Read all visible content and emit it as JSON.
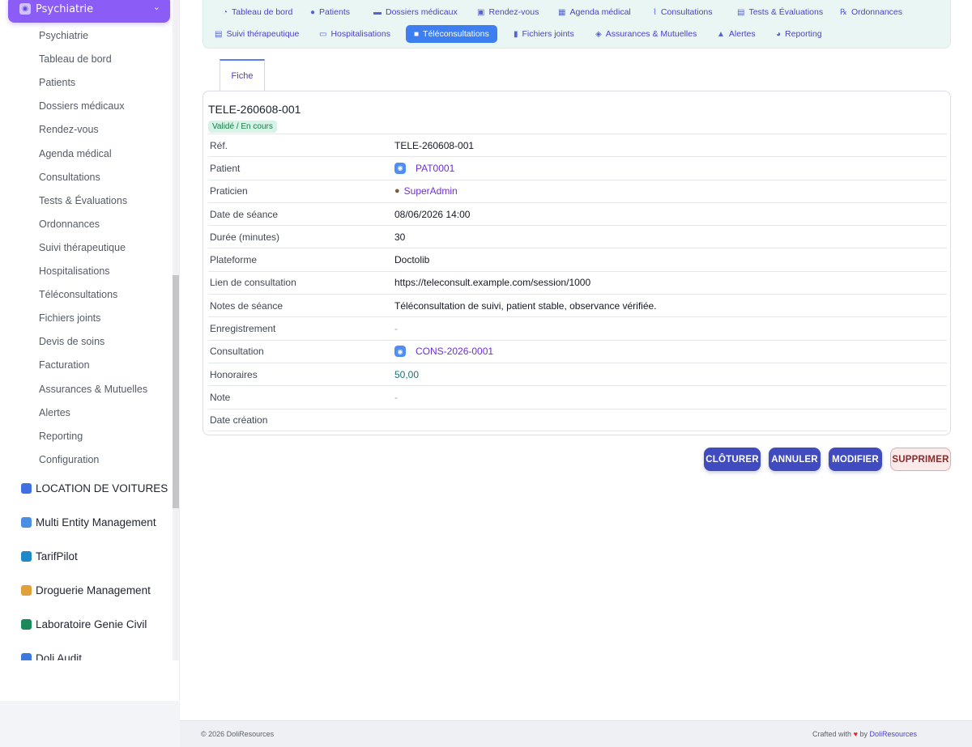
{
  "sidebar": {
    "active_module": {
      "label": "Psychiatrie",
      "icon": "brain-icon"
    },
    "sub_items": [
      "Psychiatrie",
      "Tableau de bord",
      "Patients",
      "Dossiers médicaux",
      "Rendez-vous",
      "Agenda médical",
      "Consultations",
      "Tests & Évaluations",
      "Ordonnances",
      "Suivi thérapeutique",
      "Hospitalisations",
      "Téléconsultations",
      "Fichiers joints",
      "Devis de soins",
      "Facturation",
      "Assurances & Mutuelles",
      "Alertes",
      "Reporting",
      "Configuration"
    ],
    "modules": [
      {
        "label": "LOCATION DE VOITURES",
        "icon": "car-icon",
        "color": "#3f6fe0"
      },
      {
        "label": "Multi Entity Management",
        "icon": "building-icon",
        "color": "#4a90e2"
      },
      {
        "label": "TarifPilot",
        "icon": "tag-icon",
        "color": "#1e88c9"
      },
      {
        "label": "Droguerie Management",
        "icon": "shop-icon",
        "color": "#e0a13a"
      },
      {
        "label": "Laboratoire Genie Civil",
        "icon": "lab-icon",
        "color": "#1a8a5a"
      },
      {
        "label": "Doli Audit",
        "icon": "audit-icon",
        "color": "#3b7be0"
      }
    ]
  },
  "nav_tabs": [
    {
      "label": "Tableau de bord",
      "icon": "gauge-icon"
    },
    {
      "label": "Patients",
      "icon": "user-icon"
    },
    {
      "label": "Dossiers médicaux",
      "icon": "folder-icon"
    },
    {
      "label": "Rendez-vous",
      "icon": "calendar-check-icon"
    },
    {
      "label": "Agenda médical",
      "icon": "calendar-icon"
    },
    {
      "label": "Consultations",
      "icon": "stethoscope-icon"
    },
    {
      "label": "Tests & Évaluations",
      "icon": "clipboard-icon"
    },
    {
      "label": "Ordonnances",
      "icon": "prescription-icon"
    },
    {
      "label": "Suivi thérapeutique",
      "icon": "notes-icon"
    },
    {
      "label": "Hospitalisations",
      "icon": "bed-icon"
    },
    {
      "label": "Téléconsultations",
      "icon": "video-icon",
      "active": true
    },
    {
      "label": "Fichiers joints",
      "icon": "file-icon"
    },
    {
      "label": "Assurances & Mutuelles",
      "icon": "shield-icon"
    },
    {
      "label": "Alertes",
      "icon": "warning-icon"
    },
    {
      "label": "Reporting",
      "icon": "pie-chart-icon"
    }
  ],
  "subtab": {
    "label": "Fiche"
  },
  "record": {
    "title": "TELE-260608-001",
    "status": "Validé / En cours",
    "fields": [
      {
        "label": "Réf.",
        "value": "TELE-260608-001"
      },
      {
        "label": "Patient",
        "value": "PAT0001",
        "type": "link",
        "icon": "patient-icon"
      },
      {
        "label": "Praticien",
        "value": "SuperAdmin",
        "type": "user",
        "icon": "user-icon"
      },
      {
        "label": "Date de séance",
        "value": "08/06/2026 14:00"
      },
      {
        "label": "Durée (minutes)",
        "value": "30"
      },
      {
        "label": "Plateforme",
        "value": "Doctolib"
      },
      {
        "label": "Lien de consultation",
        "value": "https://teleconsult.example.com/session/1000"
      },
      {
        "label": "Notes de séance",
        "value": "Téléconsultation de suivi, patient stable, observance vérifiée."
      },
      {
        "label": "Enregistrement",
        "value": "-",
        "type": "dash"
      },
      {
        "label": "Consultation",
        "value": "CONS-2026-0001",
        "type": "link",
        "icon": "consultation-icon"
      },
      {
        "label": "Honoraires",
        "value": "50,00",
        "type": "money"
      },
      {
        "label": "Note",
        "value": "-",
        "type": "dash"
      },
      {
        "label": "Date création",
        "value": ""
      }
    ]
  },
  "actions": {
    "close": "CLÔTURER",
    "cancel": "ANNULER",
    "edit": "MODIFIER",
    "delete": "SUPPRIMER"
  },
  "footer": {
    "copyright": "© 2026 DoliResources",
    "crafted": "Crafted with",
    "by": "by",
    "brand": "DoliResources"
  }
}
